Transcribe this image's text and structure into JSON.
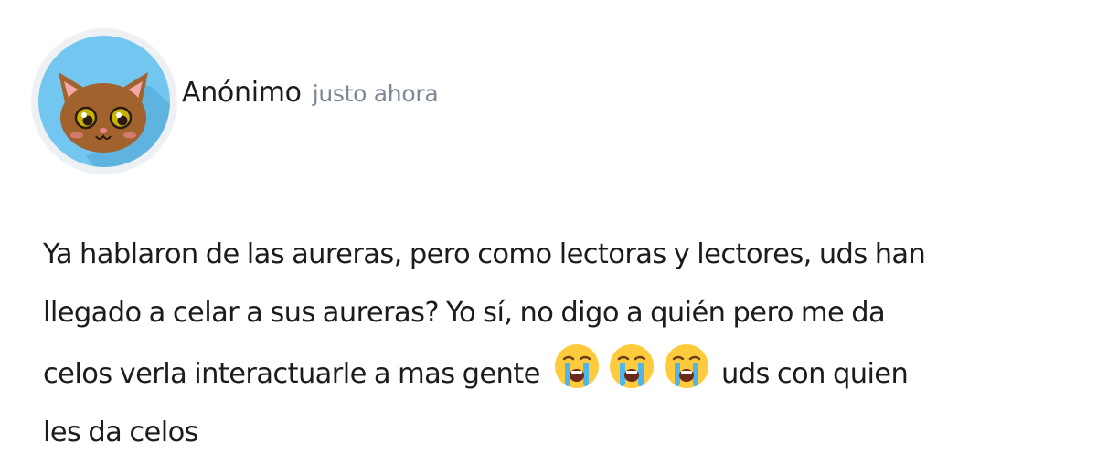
{
  "post": {
    "author": "Anónimo",
    "timestamp": "justo ahora",
    "avatar_icon": "cat-face-icon",
    "text_lines": [
      "Ya hablaron de las aureras, pero como lectoras y lectores, uds han",
      "llegado a celar a sus aureras? Yo sí, no digo a quién pero me da",
      "celos verla interactuarle a mas gente",
      "uds con quien",
      "les da celos"
    ],
    "emojis": [
      "loudly-crying-face-icon",
      "loudly-crying-face-icon",
      "loudly-crying-face-icon"
    ]
  },
  "colors": {
    "avatar_bg": "#73c6f0",
    "avatar_ring": "#eef1f4",
    "cat_fur": "#a2622d",
    "text": "#1c1c1e",
    "timestamp": "#7d8795"
  }
}
